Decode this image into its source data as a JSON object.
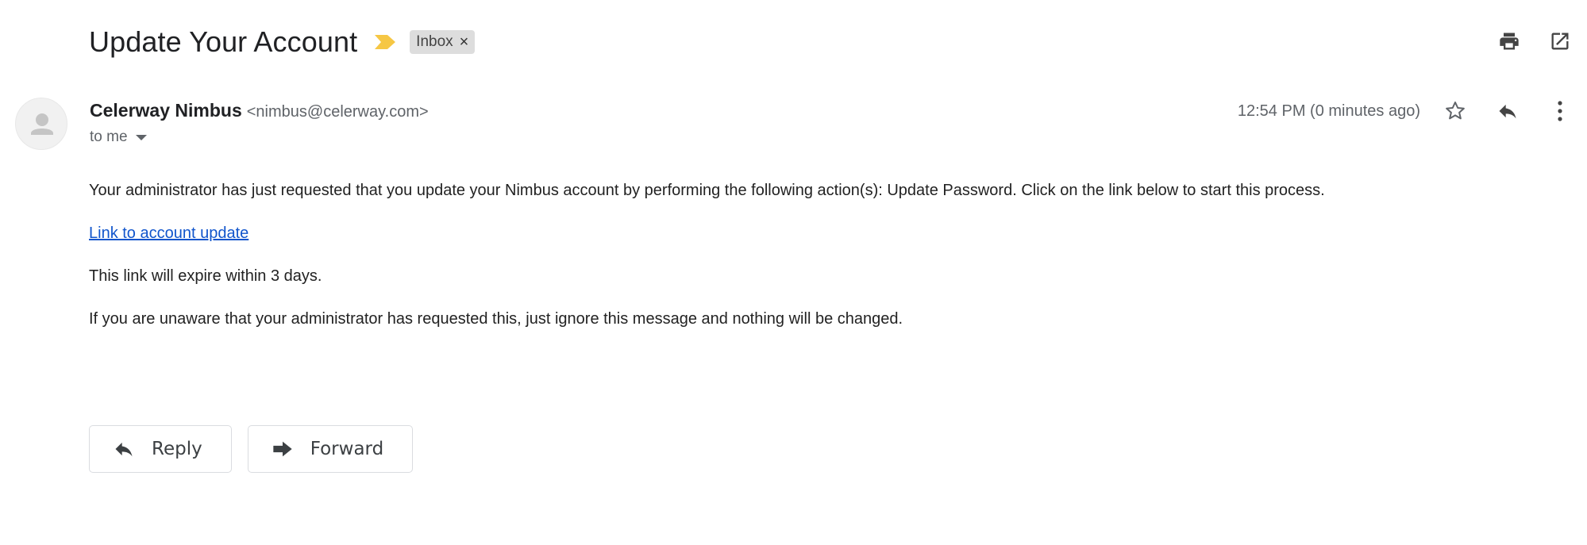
{
  "email": {
    "subject": "Update Your Account",
    "label": "Inbox",
    "label_close": "×",
    "sender_name": "Celerway Nimbus",
    "sender_email": "<nimbus@celerway.com>",
    "recipient": "to me",
    "timestamp": "12:54 PM (0 minutes ago)",
    "body": {
      "paragraph1": "Your administrator has just requested that you update your Nimbus account by performing the following action(s): Update Password. Click on the link below to start this process.",
      "link_text": "Link to account update",
      "paragraph2": "This link will expire within 3 days.",
      "paragraph3": "If you are unaware that your administrator has requested this, just ignore this message and nothing will be changed."
    }
  },
  "actions": {
    "reply_label": "Reply",
    "forward_label": "Forward"
  },
  "colors": {
    "importance_marker": "#f6c744",
    "link": "#1155cc",
    "icon": "#5f6368"
  },
  "icons": {
    "print": "print-icon",
    "open_new_window": "open-in-new-window-icon",
    "star": "star-icon",
    "reply": "reply-icon",
    "more": "more-vertical-icon",
    "forward": "forward-icon",
    "avatar": "person-icon",
    "importance": "importance-marker-icon"
  }
}
